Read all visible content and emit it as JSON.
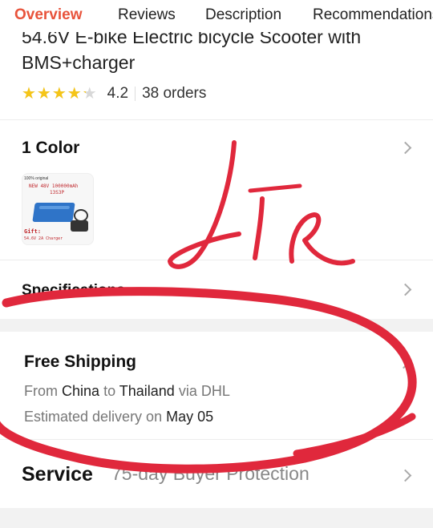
{
  "tabs": [
    {
      "label": "Overview",
      "active": true
    },
    {
      "label": "Reviews",
      "active": false
    },
    {
      "label": "Description",
      "active": false
    },
    {
      "label": "Recommendations",
      "active": false
    }
  ],
  "product": {
    "title_line1": "54.6V E-bike Electric bicycle Scooter with",
    "title_line2": "BMS+charger",
    "rating": "4.2",
    "rating_value": 4.2,
    "rating_max": 5,
    "orders": "38 orders"
  },
  "color_section": {
    "title": "1 Color",
    "thumbnail": {
      "top_text": "100% original",
      "line1": "NEW 48V 100000mAh",
      "line2": "13S3P",
      "gift_label": "Gift:",
      "gift_text": "54.6V 2A Charger"
    }
  },
  "specifications": {
    "title": "Specifications"
  },
  "shipping": {
    "title": "Free Shipping",
    "from_word": "From",
    "origin": "China",
    "to_word": "to",
    "destination": "Thailand",
    "via_word": "via DHL",
    "eta_prefix": "Estimated delivery on",
    "eta_date": "May 05"
  },
  "service": {
    "title": "Service",
    "description": "75-day Buyer Protection"
  },
  "colors": {
    "accent": "#e8533b",
    "star": "#f5c518",
    "annotation": "#e0283c"
  },
  "annotation": {
    "handwritten_text": "Lie"
  }
}
